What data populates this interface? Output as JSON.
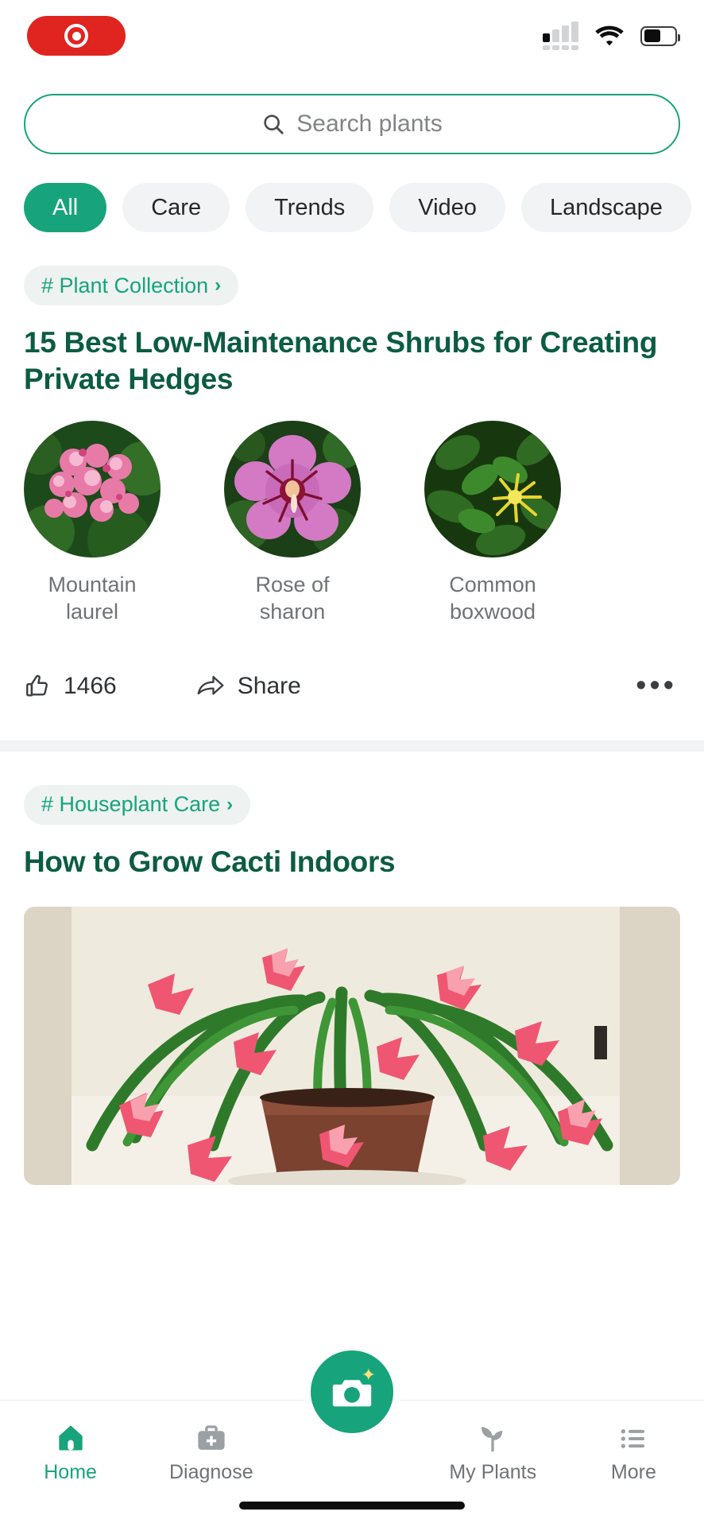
{
  "statusbar": {
    "recording_indicator": "recording-pill",
    "signal_icon": "cellular-signal-icon",
    "wifi_icon": "wifi-icon",
    "battery_icon": "battery-icon",
    "battery_level_pct": 55
  },
  "search": {
    "placeholder": "Search plants",
    "icon": "search-icon",
    "border_color": "#17a47c"
  },
  "filters": {
    "chips": [
      {
        "label": "All",
        "active": true
      },
      {
        "label": "Care",
        "active": false
      },
      {
        "label": "Trends",
        "active": false
      },
      {
        "label": "Video",
        "active": false
      },
      {
        "label": "Landscape",
        "active": false
      }
    ]
  },
  "feed": [
    {
      "tag": "# Plant Collection",
      "tag_chevron": "›",
      "headline": "15 Best Low-Maintenance Shrubs for Creating Private Hedges",
      "thumbnails": [
        {
          "caption": "Mountain laurel"
        },
        {
          "caption": "Rose of sharon"
        },
        {
          "caption": "Common boxwood"
        }
      ],
      "like_icon": "thumbs-up-icon",
      "like_count": "1466",
      "share_icon": "share-icon",
      "share_label": "Share",
      "more_icon": "more-options-icon",
      "more_label": "•••"
    },
    {
      "tag": "# Houseplant Care",
      "tag_chevron": "›",
      "headline": "How to Grow Cacti Indoors",
      "hero_image": "christmas-cactus-in-pot-on-windowsill"
    }
  ],
  "bottomnav": {
    "items": [
      {
        "label": "Home",
        "icon": "home-icon",
        "active": true
      },
      {
        "label": "Diagnose",
        "icon": "diagnose-kit-icon",
        "active": false
      },
      {
        "label": "My Plants",
        "icon": "leaf-icon",
        "active": false
      },
      {
        "label": "More",
        "icon": "list-menu-icon",
        "active": false
      }
    ],
    "fab": {
      "icon": "camera-icon",
      "sparkle": "✦"
    }
  },
  "colors": {
    "accent": "#17a47c",
    "headline": "#0c5c43",
    "chip_bg": "#f1f3f4",
    "muted_text": "#6f7376",
    "record_red": "#e0241f"
  }
}
